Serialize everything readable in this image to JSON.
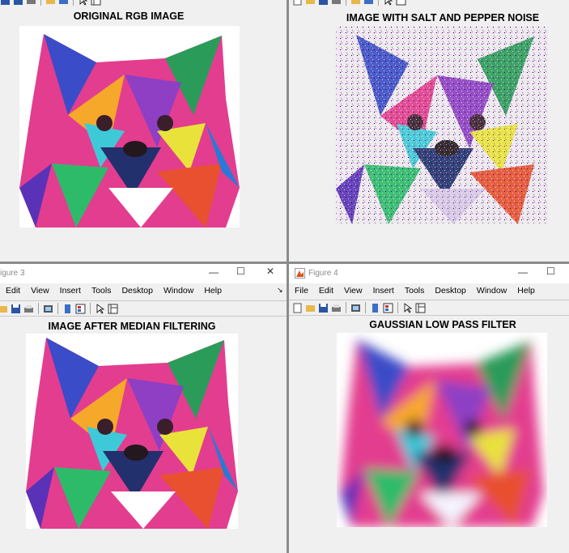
{
  "windows": {
    "fig1": {
      "plot_title": "ORIGINAL RGB IMAGE"
    },
    "fig2": {
      "plot_title": "IMAGE WITH SALT AND PEPPER NOISE"
    },
    "fig3": {
      "window_title": "igure 3",
      "menu": [
        "Edit",
        "View",
        "Insert",
        "Tools",
        "Desktop",
        "Window",
        "Help"
      ],
      "plot_title": "IMAGE AFTER MEDIAN FILTERING"
    },
    "fig4": {
      "window_title": "Figure 4",
      "menu": [
        "File",
        "Edit",
        "View",
        "Insert",
        "Tools",
        "Desktop",
        "Window",
        "Help"
      ],
      "plot_title": "GAUSSIAN LOW PASS FILTER"
    }
  },
  "controls": {
    "minimize": "—",
    "maximize": "☐",
    "close": "✕",
    "menu_arrow": "↘"
  },
  "icons": [
    "new-file-icon",
    "open-folder-icon",
    "save-icon",
    "print-icon",
    "print-preview-icon",
    "colorbar-icon",
    "legend-icon",
    "pointer-icon",
    "property-editor-icon"
  ]
}
